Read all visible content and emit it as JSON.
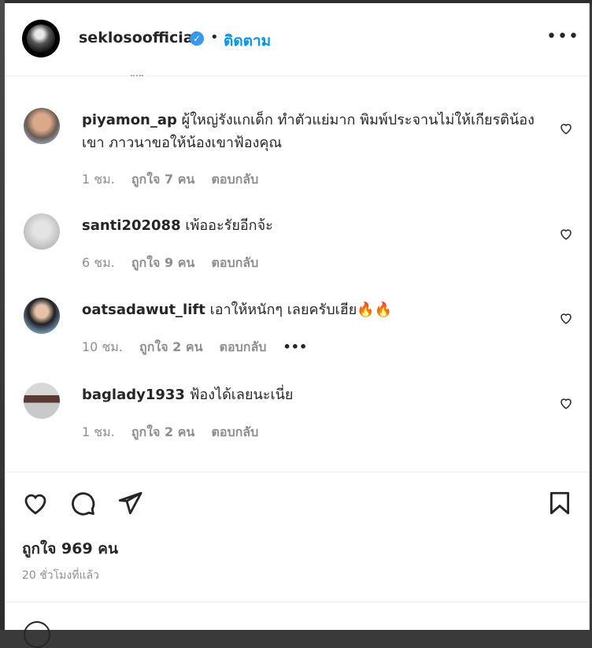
{
  "header": {
    "username": "seklosoofficial",
    "verified_icon": "verified-badge-icon",
    "separator": "•",
    "follow_label": "ติดตาม",
    "more_label": "•••"
  },
  "comments": [
    {
      "username": "piyamon_ap",
      "text": "ผู้ใหญ่รังแกเด็ก ทำตัวแย่มาก พิมพ์ประจานไม่ให้เกียรติน้องเขา ภาวนาขอให้น้องเขาฟ้องคุณ",
      "time": "1 ชม.",
      "likes": "ถูกใจ 7 คน",
      "reply": "ตอบกลับ"
    },
    {
      "username": "santi202088",
      "text": "เพ้ออะรัยอีกจ้ะ",
      "time": "6 ชม.",
      "likes": "ถูกใจ 9 คน",
      "reply": "ตอบกลับ"
    },
    {
      "username": "oatsadawut_lift",
      "text": "เอาให้หนักๆ เลยครับเฮีย🔥🔥",
      "time": "10 ชม.",
      "likes": "ถูกใจ 2 คน",
      "reply": "ตอบกลับ",
      "more": "•••"
    },
    {
      "username": "baglady1933",
      "text": "ฟ้องได้เลยนะเนี่ย",
      "time": "1 ชม.",
      "likes": "ถูกใจ 2 คน",
      "reply": "ตอบกลับ"
    }
  ],
  "post": {
    "likes_label": "ถูกใจ 969 คน",
    "time_ago": "20 ชั่วโมงที่แล้ว"
  },
  "icons": {
    "like": "heart-icon",
    "comment": "comment-bubble-icon",
    "share": "paper-plane-icon",
    "save": "bookmark-icon",
    "emoji": "emoji-icon"
  },
  "colors": {
    "accent": "#0095f6",
    "verified": "#3897f0",
    "muted": "#8e8e8e",
    "text": "#262626"
  }
}
